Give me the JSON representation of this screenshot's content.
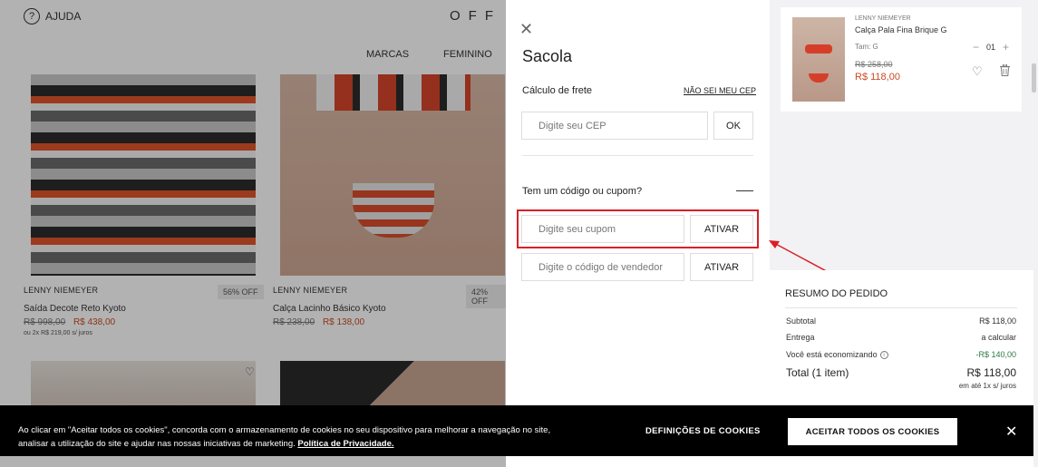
{
  "store": {
    "help_label": "AJUDA",
    "logo_text": "OFF P",
    "nav": [
      "MARCAS",
      "FEMININO"
    ],
    "products": [
      {
        "brand": "LENNY NIEMEYER",
        "badge": "56% OFF",
        "name": "Saída Decote Reto Kyoto",
        "old_price": "R$ 998,00",
        "price": "R$ 438,00",
        "installments": "ou 2x R$ 219,00 s/ juros"
      },
      {
        "brand": "LENNY NIEMEYER",
        "badge": "42% OFF",
        "name": "Calça Lacinho Básico Kyoto",
        "old_price": "R$ 238,00",
        "price": "R$ 138,00"
      }
    ]
  },
  "bag": {
    "title": "Sacola",
    "shipping_label": "Cálculo de frete",
    "dont_know_cep": "NÃO SEI MEU CEP",
    "cep_placeholder": "Digite seu CEP",
    "ok_label": "OK",
    "coupon_question": "Tem um código ou cupom?",
    "coupon_placeholder": "Digite seu cupom",
    "coupon_button": "ATIVAR",
    "seller_placeholder": "Digite o código de vendedor",
    "seller_button": "ATIVAR"
  },
  "cart_item": {
    "brand": "LENNY NIEMEYER",
    "name": "Calça Pala Fina Brique G",
    "size": "Tam: G",
    "old_price": "R$ 258,00",
    "price": "R$ 118,00",
    "quantity": "01"
  },
  "summary": {
    "title": "RESUMO DO PEDIDO",
    "subtotal_label": "Subtotal",
    "subtotal_value": "R$ 118,00",
    "shipping_label": "Entrega",
    "shipping_value": "a calcular",
    "savings_label": "Você está economizando",
    "savings_value": "-R$ 140,00",
    "total_label": "Total (1 item)",
    "total_value": "R$ 118,00",
    "total_sub": "em até 1x s/ juros"
  },
  "cookies": {
    "text": "Ao clicar em \"Aceitar todos os cookies\", concorda com o armazenamento de cookies no seu dispositivo para melhorar a navegação no site, analisar a utilização do site e ajudar nas nossas iniciativas de marketing.",
    "policy_link": "Política de Privacidade.",
    "settings_label": "DEFINIÇÕES DE COOKIES",
    "accept_label": "ACEITAR TODOS OS COOKIES"
  },
  "colors": {
    "highlight": "#d91f26",
    "price": "#c84c22",
    "savings": "#2a7a45"
  },
  "icons": [
    "help-icon",
    "close-icon",
    "heart-icon",
    "trash-icon",
    "info-icon"
  ]
}
